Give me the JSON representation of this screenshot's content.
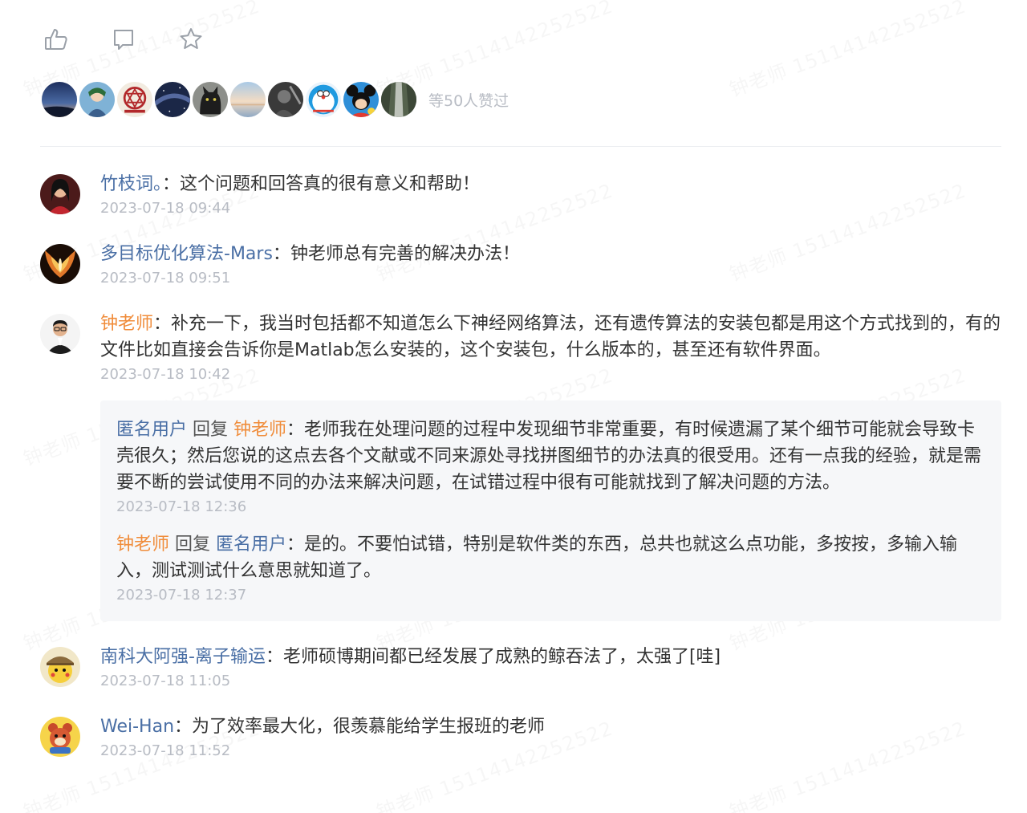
{
  "watermark_text": "钟老师 15114142252522",
  "actions": [
    {
      "name": "like-icon"
    },
    {
      "name": "comment-icon"
    },
    {
      "name": "star-icon"
    }
  ],
  "likers": {
    "count_text": "等50人赞过",
    "avatars": [
      "dusk-landscape",
      "anime-character",
      "alchemy-seal",
      "night-sky",
      "black-cat",
      "sunset-sea",
      "dark-figure",
      "doraemon",
      "mickey-mouse",
      "forest-waterfall"
    ]
  },
  "comments": [
    {
      "author": "竹枝词。",
      "sep": "：",
      "text": "这个问题和回答真的很有意义和帮助！",
      "time": "2023-07-18 09:44",
      "avatar": "girl-portrait"
    },
    {
      "author": "多目标优化算法-Mars",
      "sep": "：",
      "text": "钟老师总有完善的解决办法！",
      "time": "2023-07-18 09:51",
      "avatar": "fire-wings"
    },
    {
      "author": "钟老师",
      "sep": "：",
      "text": "补充一下，我当时包括都不知道怎么下神经网络算法，还有遗传算法的安装包都是用这个方式找到的，有的文件比如直接会告诉你是Matlab怎么安装的，这个安装包，什么版本的，甚至还有软件界面。",
      "time": "2023-07-18 10:42",
      "avatar": "teacher-portrait",
      "replies": [
        {
          "author": "匿名用户",
          "reply_word": " 回复 ",
          "target": "钟老师",
          "sep": "：",
          "text": "老师我在处理问题的过程中发现细节非常重要，有时候遗漏了某个细节可能就会导致卡壳很久；然后您说的这点去各个文献或不同来源处寻找拼图细节的办法真的很受用。还有一点我的经验，就是需要不断的尝试使用不同的办法来解决问题，在试错过程中很有可能就找到了解决问题的方法。",
          "time": "2023-07-18 12:36"
        },
        {
          "author": "钟老师",
          "reply_word": " 回复 ",
          "target": "匿名用户",
          "sep": "：",
          "text": "是的。不要怕试错，特别是软件类的东西，总共也就这么点功能，多按按，多输入输入，测试测试什么意思就知道了。",
          "time": "2023-07-18 12:37"
        }
      ]
    },
    {
      "author": "南科大阿强-离子输运",
      "sep": "：",
      "text": "老师硕博期间都已经发展了成熟的鲸吞法了，太强了[哇]",
      "time": "2023-07-18 11:05",
      "avatar": "pikachu-detective"
    },
    {
      "author": "Wei-Han",
      "sep": "：",
      "text": "为了效率最大化，很羡慕能给学生报班的老师",
      "time": "2023-07-18 11:52",
      "avatar": "cartoon-bear"
    }
  ]
}
